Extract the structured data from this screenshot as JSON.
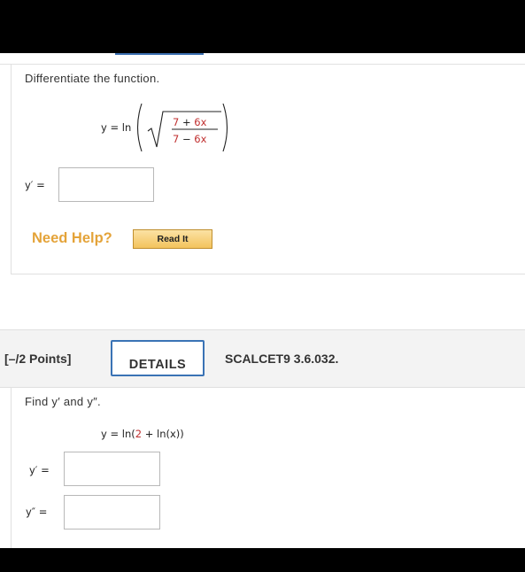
{
  "question1": {
    "instruction": "Differentiate the function.",
    "eq_lhs": "y = ln",
    "frac_num_a": "7",
    "frac_num_op": " + ",
    "frac_num_b": "6x",
    "frac_den_a": "7",
    "frac_den_op": " − ",
    "frac_den_b": "6x",
    "answer_label": "y′ =",
    "answer_value": "",
    "need_help": "Need Help?",
    "read_it": "Read It"
  },
  "question2_header": {
    "points": "[–/2 Points]",
    "details": "DETAILS",
    "code": "SCALCET9 3.6.032."
  },
  "question2": {
    "instruction": "Find y′ and y″.",
    "eq_prefix": "y = ln(",
    "eq_red": "2",
    "eq_suffix": " + ln(x))",
    "answer1_label": "y′ =",
    "answer1_value": "",
    "answer2_label": "y″ =",
    "answer2_value": ""
  },
  "colors": {
    "accent_blue": "#3a73b5",
    "need_help_orange": "#e4a339",
    "math_red": "#c03030"
  }
}
